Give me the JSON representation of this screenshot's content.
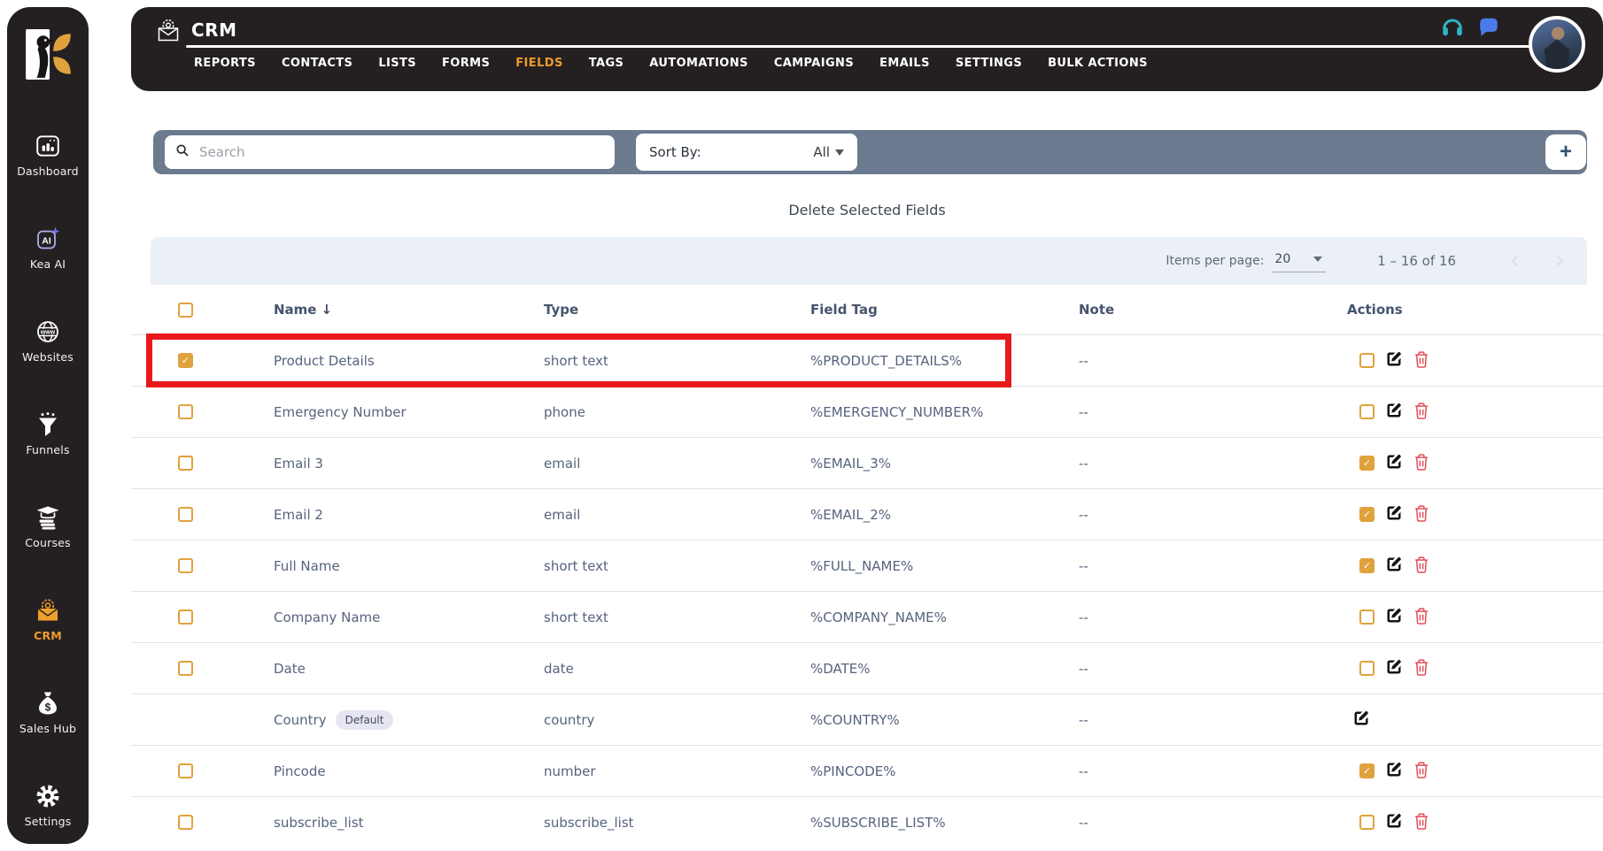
{
  "app": {
    "title": "CRM"
  },
  "sidebar": {
    "items": [
      {
        "label": "Dashboard",
        "icon": "dashboard-icon",
        "active": false
      },
      {
        "label": "Kea AI",
        "icon": "kea-ai-icon",
        "active": false
      },
      {
        "label": "Websites",
        "icon": "websites-icon",
        "active": false
      },
      {
        "label": "Funnels",
        "icon": "funnels-icon",
        "active": false
      },
      {
        "label": "Courses",
        "icon": "courses-icon",
        "active": false
      },
      {
        "label": "CRM",
        "icon": "crm-icon",
        "active": true
      },
      {
        "label": "Sales Hub",
        "icon": "sales-hub-icon",
        "active": false
      },
      {
        "label": "Settings",
        "icon": "settings-icon",
        "active": false
      }
    ]
  },
  "nav": {
    "items": [
      {
        "label": "REPORTS",
        "active": false
      },
      {
        "label": "CONTACTS",
        "active": false
      },
      {
        "label": "LISTS",
        "active": false
      },
      {
        "label": "FORMS",
        "active": false
      },
      {
        "label": "FIELDS",
        "active": true
      },
      {
        "label": "TAGS",
        "active": false
      },
      {
        "label": "AUTOMATIONS",
        "active": false
      },
      {
        "label": "CAMPAIGNS",
        "active": false
      },
      {
        "label": "EMAILS",
        "active": false
      },
      {
        "label": "SETTINGS",
        "active": false
      },
      {
        "label": "BULK ACTIONS",
        "active": false
      }
    ]
  },
  "header_icons": [
    "headphones-icon",
    "chat-icon",
    "avatar"
  ],
  "toolbar": {
    "search_placeholder": "Search",
    "sort_label": "Sort By:",
    "sort_value": "All",
    "add_button": "+"
  },
  "actions_bar": {
    "delete_selected_label": "Delete Selected Fields"
  },
  "pagination": {
    "items_per_page_label": "Items per page:",
    "items_per_page_value": "20",
    "range_text": "1 – 16 of 16"
  },
  "table": {
    "columns": [
      "Name",
      "Type",
      "Field Tag",
      "Note",
      "Actions"
    ],
    "sort_column": "Name",
    "rows": [
      {
        "name": "Product Details",
        "type": "short text",
        "field_tag": "%PRODUCT_DETAILS%",
        "note": "--",
        "badge": null,
        "has_checkbox": true,
        "selected": true,
        "action_checked": false,
        "edit_only": false,
        "highlighted": true
      },
      {
        "name": "Emergency Number",
        "type": "phone",
        "field_tag": "%EMERGENCY_NUMBER%",
        "note": "--",
        "badge": null,
        "has_checkbox": true,
        "selected": false,
        "action_checked": false,
        "edit_only": false,
        "highlighted": false
      },
      {
        "name": "Email 3",
        "type": "email",
        "field_tag": "%EMAIL_3%",
        "note": "--",
        "badge": null,
        "has_checkbox": true,
        "selected": false,
        "action_checked": true,
        "edit_only": false,
        "highlighted": false
      },
      {
        "name": "Email 2",
        "type": "email",
        "field_tag": "%EMAIL_2%",
        "note": "--",
        "badge": null,
        "has_checkbox": true,
        "selected": false,
        "action_checked": true,
        "edit_only": false,
        "highlighted": false
      },
      {
        "name": "Full Name",
        "type": "short text",
        "field_tag": "%FULL_NAME%",
        "note": "--",
        "badge": null,
        "has_checkbox": true,
        "selected": false,
        "action_checked": true,
        "edit_only": false,
        "highlighted": false
      },
      {
        "name": "Company Name",
        "type": "short text",
        "field_tag": "%COMPANY_NAME%",
        "note": "--",
        "badge": null,
        "has_checkbox": true,
        "selected": false,
        "action_checked": false,
        "edit_only": false,
        "highlighted": false
      },
      {
        "name": "Date",
        "type": "date",
        "field_tag": "%DATE%",
        "note": "--",
        "badge": null,
        "has_checkbox": true,
        "selected": false,
        "action_checked": false,
        "edit_only": false,
        "highlighted": false
      },
      {
        "name": "Country",
        "type": "country",
        "field_tag": "%COUNTRY%",
        "note": "--",
        "badge": "Default",
        "has_checkbox": false,
        "selected": false,
        "action_checked": false,
        "edit_only": true,
        "highlighted": false
      },
      {
        "name": "Pincode",
        "type": "number",
        "field_tag": "%PINCODE%",
        "note": "--",
        "badge": null,
        "has_checkbox": true,
        "selected": false,
        "action_checked": true,
        "edit_only": false,
        "highlighted": false
      },
      {
        "name": "subscribe_list",
        "type": "subscribe_list",
        "field_tag": "%SUBSCRIBE_LIST%",
        "note": "--",
        "badge": null,
        "has_checkbox": true,
        "selected": false,
        "action_checked": false,
        "edit_only": false,
        "highlighted": false
      }
    ]
  },
  "colors": {
    "dark_bg": "#242021",
    "accent_orange": "#EE9B2D",
    "checkbox_gold": "#DFA23C",
    "toolbar_slate": "#6B7A8E",
    "pagebar_bg": "#EAF0F5",
    "table_text": "#56637D",
    "trash_red": "#E14B57",
    "annotation_red": "#E9191B",
    "chat_blue": "#4B7BEA",
    "headphones_teal": "#2FB4C6",
    "ai_purple": "#7A6FE3"
  }
}
